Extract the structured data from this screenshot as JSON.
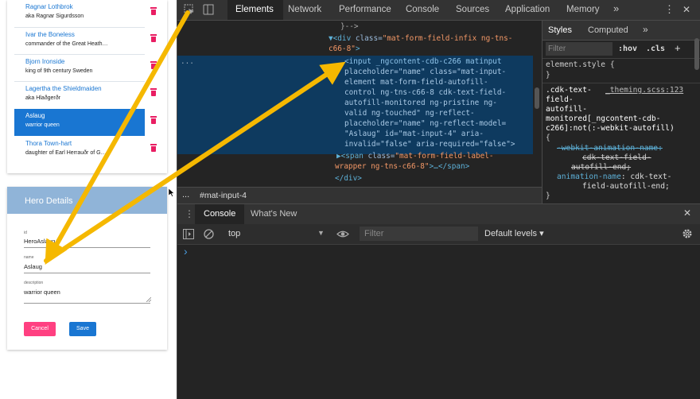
{
  "app": {
    "hero_list": [
      {
        "name": "Ragnar Lothbrok",
        "description": "aka Ragnar Sigurdsson"
      },
      {
        "name": "Ivar the Boneless",
        "description": "commander of the Great Heath…"
      },
      {
        "name": "Bjorn Ironside",
        "description": "king of 9th century Sweden"
      },
      {
        "name": "Lagertha the Shieldmaiden",
        "description": "aka Hlaðgerðr"
      },
      {
        "name": "Aslaug",
        "description": "warrior queen"
      },
      {
        "name": "Thora Town-hart",
        "description": "daughter of Earl Herrauðr of G…"
      }
    ],
    "details": {
      "title": "Hero Details",
      "id_label": "id",
      "id_value": "HeroAslaug",
      "name_label": "name",
      "name_value": "Aslaug",
      "description_label": "description",
      "description_value": "warrior queen",
      "cancel_label": "Cancel",
      "save_label": "Save"
    }
  },
  "devtools": {
    "tabs": [
      "Elements",
      "Network",
      "Performance",
      "Console",
      "Sources",
      "Application",
      "Memory"
    ],
    "more_tabs": "»",
    "menu_dots": "⋮",
    "close": "✕",
    "code_lines": {
      "l0": "}-->",
      "l1_tag_open": "▼<div ",
      "l1_attr": "class=",
      "l1_val": "\"mat-form-field-infix ng-tns-",
      "l2_val": "c66-8\"",
      "l2_tag": ">",
      "ellipsis": "...",
      "sel1": "<input _ngcontent-cdb-c266 matinput",
      "sel2": "placeholder=\"name\" class=\"mat-input-",
      "sel3": "element mat-form-field-autofill-",
      "sel4": "control ng-tns-c66-8 cdk-text-field-",
      "sel5": "autofill-monitored ng-pristine ng-",
      "sel6": "valid ng-touched\" ng-reflect-",
      "sel7": "placeholder=\"name\" ng-reflect-model=",
      "sel8": "\"Aslaug\" id=\"mat-input-4\" aria-",
      "sel9": "invalid=\"false\" aria-required=\"false\">",
      "after1_tag": "▶<span ",
      "after1_attr": "class=",
      "after1_val": "\"mat-form-field-label-",
      "after2_val": "wrapper ng-tns-c66-8\"",
      "after2_tag": ">…</span>",
      "after3": "</div>"
    },
    "styles": {
      "tab_styles": "Styles",
      "tab_computed": "Computed",
      "more": "»",
      "filter_placeholder": "Filter",
      "hov": ":hov",
      "cls": ".cls",
      "plus": "+",
      "element_style": "element.style {",
      "close_brace": "}",
      "rule_selector_1": ".cdk-text-",
      "rule_selector_2": "field-",
      "rule_selector_3": "autofill-",
      "rule_selector_4": "monitored[_ngcontent-cdb-",
      "rule_selector_5": "c266]:not(:-webkit-autofill)",
      "rule_open": "{",
      "rule_source": "_theming.scss:123",
      "struck_1": "-webkit-animation-name:",
      "struck_2": "cdk-text-field-",
      "struck_3": "autofill-end;",
      "prop_name": "animation-name",
      "prop_val_1": ": cdk-text-",
      "prop_val_2": "field-autofill-end;",
      "rule_close": "}"
    },
    "breadcrumb_dots": "...",
    "breadcrumb": "#mat-input-4",
    "drawer_tab_console": "Console",
    "drawer_tab_whatsnew": "What's New",
    "context": "top",
    "filter_placeholder": "Filter",
    "levels": "Default levels ▾",
    "prompt": "›"
  },
  "colors": {
    "accent_blue": "#1976d2",
    "pink": "#ff4081",
    "arrow": "#f5b800"
  }
}
